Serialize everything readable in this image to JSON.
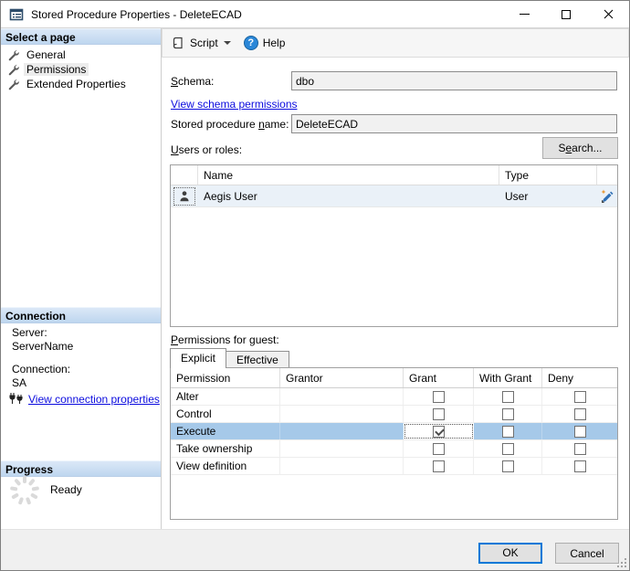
{
  "window": {
    "title": "Stored Procedure Properties - DeleteECAD"
  },
  "sidebar": {
    "select_page": {
      "title": "Select a page",
      "items": [
        {
          "label": "General",
          "selected": false
        },
        {
          "label": "Permissions",
          "selected": true
        },
        {
          "label": "Extended Properties",
          "selected": false
        }
      ]
    },
    "connection": {
      "title": "Connection",
      "server_label": "Server:",
      "server_value": "ServerName",
      "connection_label": "Connection:",
      "connection_value": "SA",
      "link_label": "View connection properties"
    },
    "progress": {
      "title": "Progress",
      "status": "Ready"
    }
  },
  "toolbar": {
    "script_label": "Script",
    "help_label": "Help"
  },
  "main": {
    "schema": {
      "label_pre": "",
      "label_key": "S",
      "label_post": "chema:",
      "value": "dbo"
    },
    "schema_link": "View schema permissions",
    "procedure": {
      "label_pre": "Stored procedure ",
      "label_key": "n",
      "label_post": "ame:",
      "value": "DeleteECAD"
    },
    "users": {
      "label_pre": "",
      "label_key": "U",
      "label_post": "sers or roles:",
      "search_pre": "S",
      "search_key": "e",
      "search_post": "arch...",
      "columns": [
        "Name",
        "Type"
      ],
      "rows": [
        {
          "name": "Aegis User",
          "type": "User"
        }
      ]
    },
    "permissions": {
      "label_pre": "",
      "label_key": "P",
      "label_post": "ermissions for guest:",
      "tabs": [
        {
          "label": "Explicit",
          "active": true
        },
        {
          "label": "Effective",
          "active": false
        }
      ],
      "columns": [
        "Permission",
        "Grantor",
        "Grant",
        "With Grant",
        "Deny"
      ],
      "rows": [
        {
          "permission": "Alter",
          "grantor": "",
          "grant": false,
          "with_grant": false,
          "deny": false,
          "selected": false,
          "focused_cell": null
        },
        {
          "permission": "Control",
          "grantor": "",
          "grant": false,
          "with_grant": false,
          "deny": false,
          "selected": false,
          "focused_cell": null
        },
        {
          "permission": "Execute",
          "grantor": "",
          "grant": true,
          "with_grant": false,
          "deny": false,
          "selected": true,
          "focused_cell": "grant"
        },
        {
          "permission": "Take ownership",
          "grantor": "",
          "grant": false,
          "with_grant": false,
          "deny": false,
          "selected": false,
          "focused_cell": null
        },
        {
          "permission": "View definition",
          "grantor": "",
          "grant": false,
          "with_grant": false,
          "deny": false,
          "selected": false,
          "focused_cell": null
        }
      ]
    }
  },
  "footer": {
    "ok_label": "OK",
    "cancel_label": "Cancel"
  },
  "colors": {
    "accent": "#0078d7",
    "selection_blue": "#a6c9e9",
    "row_highlight": "#eaf1f8",
    "link": "#0b0bde",
    "header_gradient_top": "#dbe8f7",
    "header_gradient_bottom": "#bed6ef"
  }
}
